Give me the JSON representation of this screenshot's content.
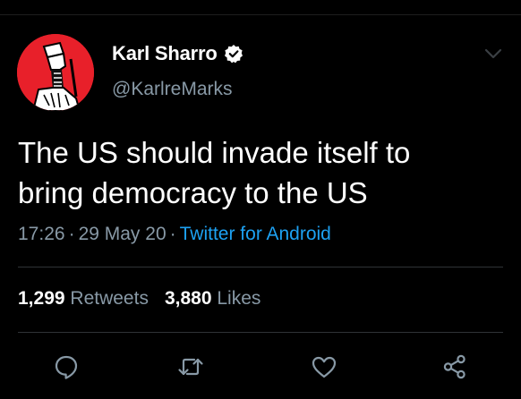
{
  "tweet": {
    "display_name": "Karl Sharro",
    "handle": "@KarlreMarks",
    "text_line_1": "The US should invade itself to",
    "text_line_2": "bring democracy to the US",
    "time": "17:26",
    "date": "29 May 20",
    "separator": "·",
    "source": "Twitter for Android"
  },
  "stats": {
    "retweets_count": "1,299",
    "retweets_label": "Retweets",
    "likes_count": "3,880",
    "likes_label": "Likes"
  },
  "icons": {
    "verified": "verified-badge-icon",
    "menu": "chevron-down-icon",
    "reply": "reply-icon",
    "retweet": "retweet-icon",
    "like": "heart-icon",
    "share": "share-icon"
  },
  "colors": {
    "background": "#000000",
    "text": "#ffffff",
    "secondary": "#8899a6",
    "link": "#1da1f2",
    "avatar_bg": "#e8202a"
  }
}
